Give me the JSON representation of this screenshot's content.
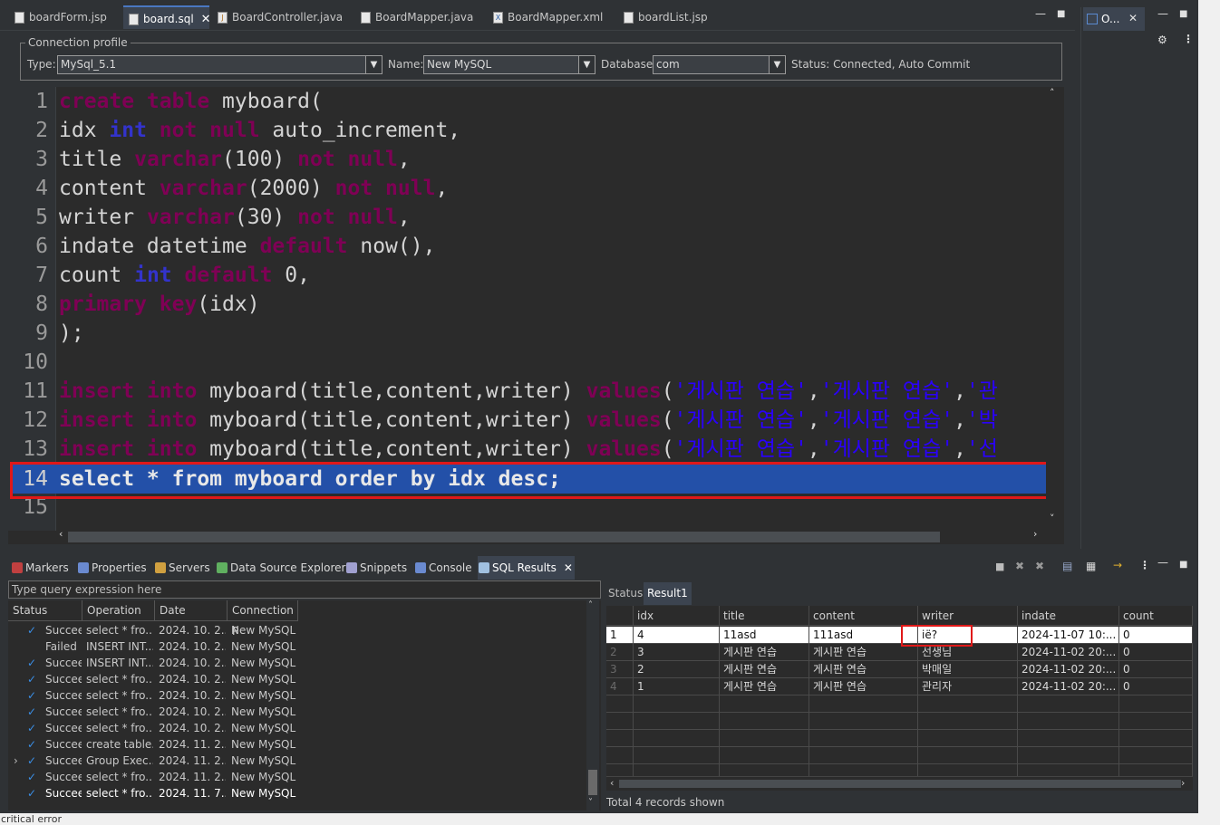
{
  "editor_tabs": [
    {
      "label": "boardForm.jsp",
      "icon": "jsp-file-icon"
    },
    {
      "label": "board.sql",
      "icon": "sql-file-icon",
      "active": true
    },
    {
      "label": "BoardController.java",
      "icon": "java-file-icon"
    },
    {
      "label": "BoardMapper.java",
      "icon": "java-file-icon"
    },
    {
      "label": "BoardMapper.xml",
      "icon": "xml-file-icon"
    },
    {
      "label": "boardList.jsp",
      "icon": "jsp-file-icon"
    }
  ],
  "connection": {
    "legend": "Connection profile",
    "type_label": "Type:",
    "type_value": "MySql_5.1",
    "name_label": "Name:",
    "name_value": "New MySQL",
    "db_label": "Database:",
    "db_value": "com",
    "status_label": "Status:",
    "status_value": "Connected, Auto Commit"
  },
  "code_lines": [
    "1",
    "2",
    "3",
    "4",
    "5",
    "6",
    "7",
    "8",
    "9",
    "10",
    "11",
    "12",
    "13",
    "14",
    "15"
  ],
  "code": {
    "l1": [
      "create table",
      " myboard("
    ],
    "l2": [
      "idx ",
      "int",
      " ",
      "not null",
      " auto_increment,"
    ],
    "l3": [
      "title ",
      "varchar",
      "(100) ",
      "not null",
      ","
    ],
    "l4": [
      "content ",
      "varchar",
      "(2000) ",
      "not null",
      ","
    ],
    "l5": [
      "writer ",
      "varchar",
      "(30) ",
      "not null",
      ","
    ],
    "l6": [
      "indate datetime ",
      "default",
      " now(),"
    ],
    "l7": [
      "count ",
      "int",
      " ",
      "default",
      " 0,"
    ],
    "l8": [
      "primary key",
      "(idx)"
    ],
    "l9": [
      ");"
    ],
    "l11": [
      "insert into",
      " myboard(title,content,writer) ",
      "values",
      "(",
      "'게시판 연습'",
      ",",
      "'게시판 연습'",
      ",",
      "'관"
    ],
    "l12": [
      "insert into",
      " myboard(title,content,writer) ",
      "values",
      "(",
      "'게시판 연습'",
      ",",
      "'게시판 연습'",
      ",",
      "'박"
    ],
    "l13": [
      "insert into",
      " myboard(title,content,writer) ",
      "values",
      "(",
      "'게시판 연습'",
      ",",
      "'게시판 연습'",
      ",",
      "'선"
    ],
    "l14": "select * from myboard order by idx desc;"
  },
  "outline_tab": "O...",
  "view_tabs": [
    {
      "label": "Markers",
      "icon": "markers-icon",
      "color": "#c04040"
    },
    {
      "label": "Properties",
      "icon": "properties-icon",
      "color": "#6a8ad0"
    },
    {
      "label": "Servers",
      "icon": "servers-icon",
      "color": "#d0a040"
    },
    {
      "label": "Data Source Explorer",
      "icon": "data-source-icon",
      "color": "#60b060"
    },
    {
      "label": "Snippets",
      "icon": "snippets-icon",
      "color": "#a0a0d0"
    },
    {
      "label": "Console",
      "icon": "console-icon",
      "color": "#6a8ad0"
    },
    {
      "label": "SQL Results",
      "icon": "sql-results-icon",
      "color": "#a0c0e0",
      "active": true
    }
  ],
  "history": {
    "filter_placeholder": "Type query expression here",
    "columns": [
      "Status",
      "Operation",
      "Date",
      "Connection P"
    ],
    "rows": [
      {
        "status": "Succeeded",
        "ok": true,
        "op": "select * fro...",
        "date": "2024. 10. 2...",
        "conn": "New MySQL"
      },
      {
        "status": "Failed",
        "ok": false,
        "op": "INSERT INT...",
        "date": "2024. 10. 2...",
        "conn": "New MySQL"
      },
      {
        "status": "Succeeded",
        "ok": true,
        "op": "INSERT INT...",
        "date": "2024. 10. 2...",
        "conn": "New MySQL"
      },
      {
        "status": "Succeeded",
        "ok": true,
        "op": "select * fro...",
        "date": "2024. 10. 2...",
        "conn": "New MySQL"
      },
      {
        "status": "Succeeded",
        "ok": true,
        "op": "select * fro...",
        "date": "2024. 10. 2...",
        "conn": "New MySQL"
      },
      {
        "status": "Succeeded",
        "ok": true,
        "op": "select * fro...",
        "date": "2024. 10. 2...",
        "conn": "New MySQL"
      },
      {
        "status": "Succeeded",
        "ok": true,
        "op": "select * fro...",
        "date": "2024. 10. 2...",
        "conn": "New MySQL"
      },
      {
        "status": "Succeeded",
        "ok": true,
        "op": "create table...",
        "date": "2024. 11. 2...",
        "conn": "New MySQL"
      },
      {
        "status": "Succeeded",
        "ok": true,
        "op": "Group Exec...",
        "date": "2024. 11. 2...",
        "conn": "New MySQL",
        "expandable": true
      },
      {
        "status": "Succeeded",
        "ok": true,
        "op": "select * fro...",
        "date": "2024. 11. 2...",
        "conn": "New MySQL"
      },
      {
        "status": "Succeeded",
        "ok": true,
        "op": "select * fro...",
        "date": "2024. 11. 7...",
        "conn": "New MySQL"
      }
    ]
  },
  "result": {
    "tabs": [
      "Status",
      "Result1"
    ],
    "columns": [
      "idx",
      "title",
      "content",
      "writer",
      "indate",
      "count"
    ],
    "rows": [
      {
        "n": "1",
        "idx": "4",
        "title": "11asd",
        "content": "111asd",
        "writer": "ië?",
        "indate": "2024-11-07 10:...",
        "count": "0"
      },
      {
        "n": "2",
        "idx": "3",
        "title": "게시판 연습",
        "content": "게시판 연습",
        "writer": "선생님",
        "indate": "2024-11-02 20:...",
        "count": "0"
      },
      {
        "n": "3",
        "idx": "2",
        "title": "게시판 연습",
        "content": "게시판 연습",
        "writer": "박매일",
        "indate": "2024-11-02 20:...",
        "count": "0"
      },
      {
        "n": "4",
        "idx": "1",
        "title": "게시판 연습",
        "content": "게시판 연습",
        "writer": "관리자",
        "indate": "2024-11-02 20:...",
        "count": "0"
      }
    ],
    "footer": "Total 4 records shown"
  },
  "statusbar": {
    "left": "critical error"
  }
}
